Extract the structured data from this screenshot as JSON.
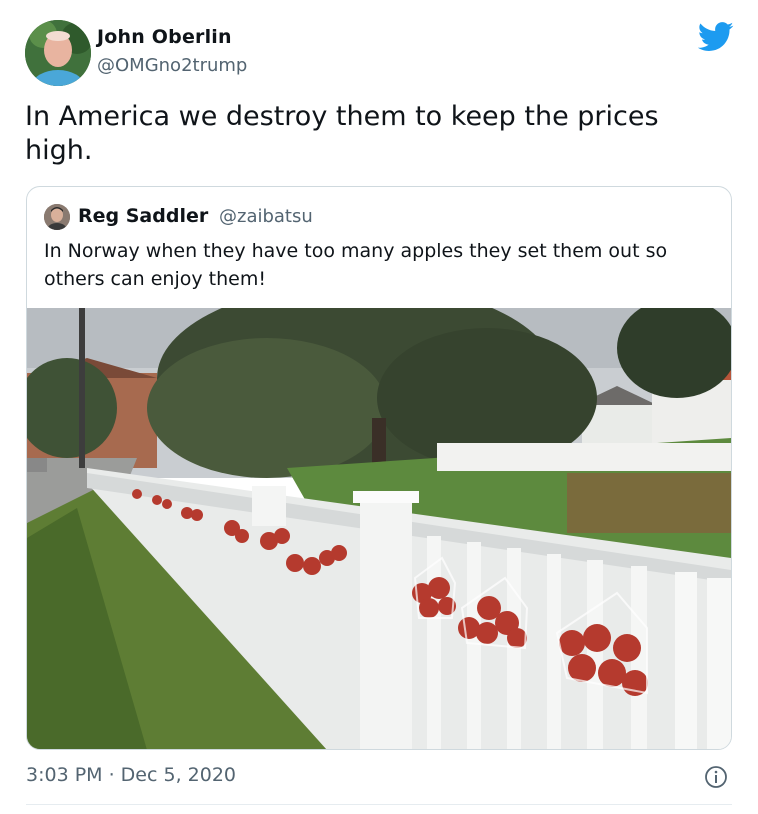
{
  "author": {
    "name": "John Oberlin",
    "handle": "@OMGno2trump",
    "avatar_icon": "profile-photo"
  },
  "tweet": {
    "text": "In America we destroy them to keep the prices\nhigh."
  },
  "quoted_tweet": {
    "name": "Reg Saddler",
    "handle": "@zaibatsu",
    "text": "In Norway when they have too many apples they set them out so others can enjoy them!",
    "photo_icon": "photo-fence-apples"
  },
  "footer": {
    "timestamp": "3:03 PM · Dec 5, 2020",
    "info_icon": "info-icon"
  },
  "colors": {
    "twitter_blue": "#1d9bf0",
    "text_primary": "#0f1419",
    "text_secondary": "#536471",
    "border": "#cfd9de"
  }
}
